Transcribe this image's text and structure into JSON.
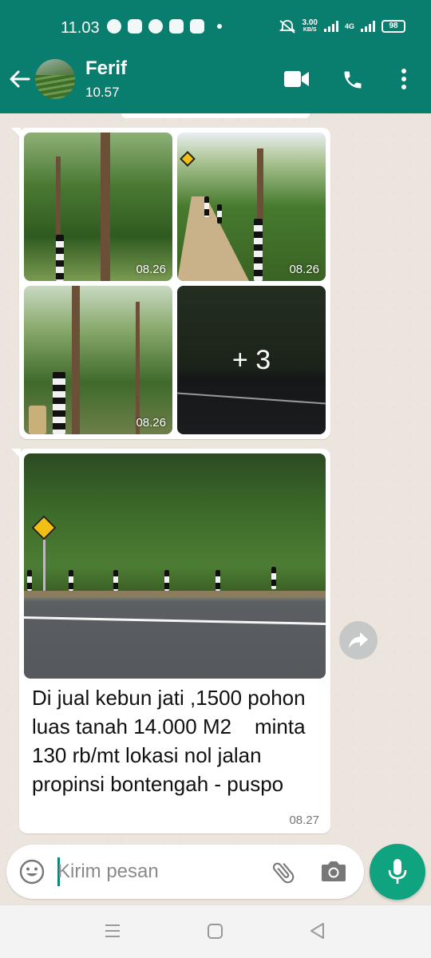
{
  "status_bar": {
    "time": "11.03",
    "net_speed": "3.00",
    "net_unit": "KB/S",
    "network": "4G",
    "battery": "98"
  },
  "header": {
    "contact_name": "Ferif",
    "contact_status": "10.57"
  },
  "messages": [
    {
      "type": "photo-group",
      "photos": [
        {
          "time": "08.26"
        },
        {
          "time": "08.26"
        },
        {
          "time": "08.26"
        },
        {
          "overlay": "+ 3"
        }
      ]
    },
    {
      "type": "photo-caption",
      "text": "Di jual kebun jati ,1500 pohon luas tanah 14.000 M2    minta 130 rb/mt lokasi nol jalan propinsi bontengah - puspo",
      "time": "08.27"
    }
  ],
  "composer": {
    "placeholder": "Kirim pesan"
  },
  "icons": {
    "back": "arrow-left-icon",
    "video": "video-call-icon",
    "call": "phone-icon",
    "more": "more-vert-icon",
    "forward": "forward-icon",
    "emoji": "emoji-icon",
    "attach": "paperclip-icon",
    "camera": "camera-icon",
    "mic": "mic-icon"
  },
  "colors": {
    "header": "#0a7e6e",
    "chat_bg": "#ece5dd",
    "mic_button": "#0fa37f"
  }
}
